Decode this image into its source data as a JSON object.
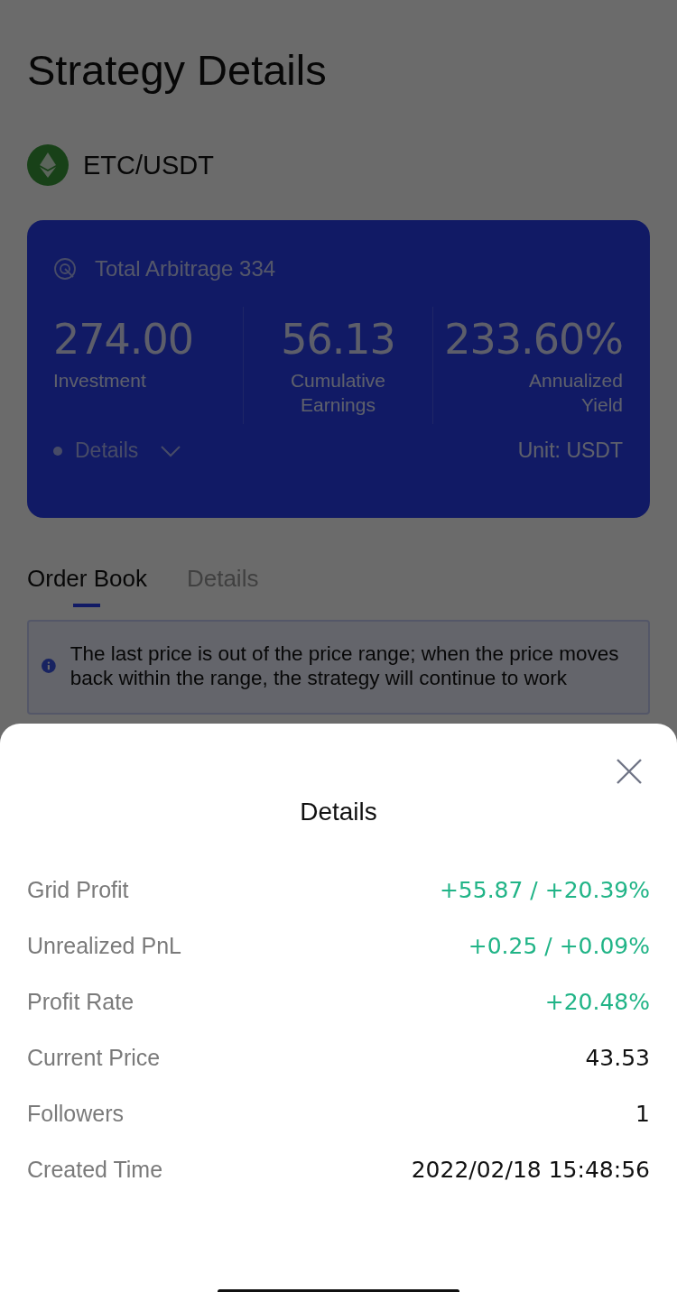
{
  "page": {
    "title": "Strategy Details"
  },
  "pair": {
    "name": "ETC/USDT"
  },
  "summary": {
    "title": "Total Arbitrage 334",
    "stats": [
      {
        "value": "274.00",
        "label": "Investment"
      },
      {
        "value": "56.13",
        "label": "Cumulative Earnings"
      },
      {
        "value": "233.60%",
        "label": "Annualized Yield"
      }
    ],
    "details_toggle": {
      "label": "Details",
      "expanded": false
    },
    "unit": "Unit: USDT"
  },
  "tabs": [
    {
      "label": "Order Book",
      "selected": true
    },
    {
      "label": "Details",
      "selected": false
    }
  ],
  "notice": "The last price is out of the price range; when the price moves back within the range, the strategy will continue to work",
  "sheet": {
    "title": "Details",
    "rows": [
      {
        "label": "Grid Profit",
        "value": "+55.87 / +20.39%",
        "kind": "gain"
      },
      {
        "label": "Unrealized PnL",
        "value": "+0.25 / +0.09%",
        "kind": "gain"
      },
      {
        "label": "Profit Rate",
        "value": "+20.48%",
        "kind": "gain"
      },
      {
        "label": "Current Price",
        "value": "43.53",
        "kind": "plain"
      },
      {
        "label": "Followers",
        "value": "1",
        "kind": "plain"
      },
      {
        "label": "Created Time",
        "value": "2022/02/18 15:48:56",
        "kind": "plain"
      }
    ]
  }
}
